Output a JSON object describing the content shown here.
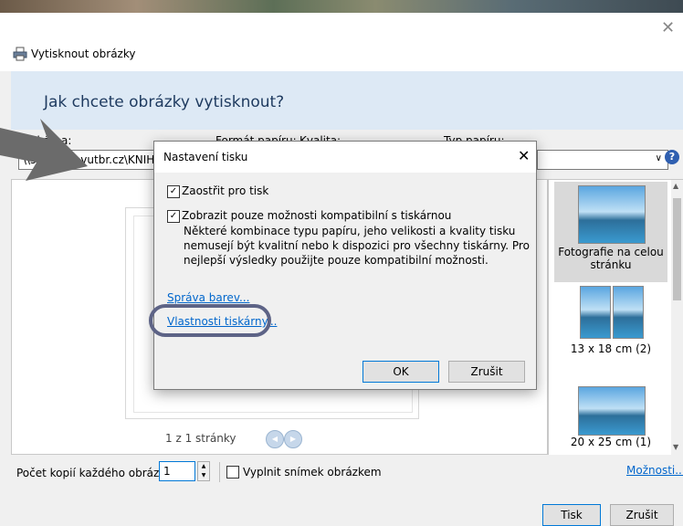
{
  "window": {
    "title": "Vytisknout obrázky",
    "heading": "Jak chcete obrázky vytisknout?"
  },
  "printer": {
    "label": "Tiskárna:",
    "value": "\\\\selma.fa.vutbr.cz\\KNIHO"
  },
  "paper_size": {
    "label": "Formát papíru:"
  },
  "quality": {
    "label": "Kvalita:"
  },
  "paper_type": {
    "label": "Typ papíru:"
  },
  "preview": {
    "pager": "1 z 1 stránky"
  },
  "layouts": [
    {
      "label": "Fotografie na celou stránku",
      "selected": true
    },
    {
      "label": "13 x 18 cm (2)",
      "selected": false
    },
    {
      "label": "20 x 25 cm (1)",
      "selected": false
    }
  ],
  "bottom": {
    "copies_label": "Počet kopií každého obrázku:",
    "copies_value": "1",
    "fill_label": "Vyplnit snímek obrázkem",
    "options_link": "Možnosti...",
    "print_button": "Tisk",
    "cancel_button": "Zrušit"
  },
  "dialog": {
    "title": "Nastavení tisku",
    "sharpen_label": "Zaostřit pro tisk",
    "sharpen_checked": true,
    "compat_label": "Zobrazit pouze možnosti kompatibilní s tiskárnou",
    "compat_checked": true,
    "compat_description": "Některé kombinace typu papíru, jeho velikosti a kvality tisku nemusejí být kvalitní nebo k dispozici pro všechny tiskárny. Pro nejlepší výsledky použijte pouze kompatibilní možnosti.",
    "color_link": "Správa barev...",
    "printer_props_link": "Vlastnosti tiskárny...",
    "ok_button": "OK",
    "cancel_button": "Zrušit"
  },
  "colors": {
    "accent": "#0078d7",
    "link": "#0066cc",
    "banner": "#dde9f5",
    "highlight_ring": "#5d6386"
  }
}
